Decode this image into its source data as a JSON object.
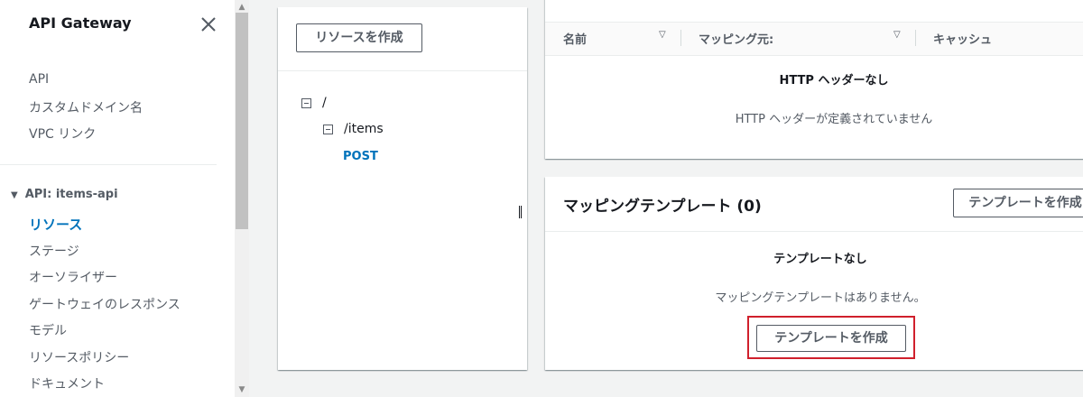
{
  "sidebar": {
    "title": "API Gateway",
    "top_links": [
      "API",
      "カスタムドメイン名",
      "VPC リンク"
    ],
    "section_label": "API: items-api",
    "section_links": [
      "リソース",
      "ステージ",
      "オーソライザー",
      "ゲートウェイのレスポンス",
      "モデル",
      "リソースポリシー",
      "ドキュメント"
    ],
    "active_item": "リソース"
  },
  "resources": {
    "create_button": "リソースを作成",
    "tree": [
      {
        "path": "/",
        "level": 0
      },
      {
        "path": "/items",
        "level": 1
      }
    ],
    "method": "POST"
  },
  "http_headers": {
    "columns": [
      "名前",
      "マッピング元:",
      "キャッシュ"
    ],
    "empty_title": "HTTP ヘッダーなし",
    "empty_text": "HTTP ヘッダーが定義されていません"
  },
  "mapping_templates": {
    "title": "マッピングテンプレート (0)",
    "header_button": "テンプレートを作成",
    "empty_title": "テンプレートなし",
    "empty_text": "マッピングテンプレートはありません。",
    "create_button": "テンプレートを作成"
  },
  "colors": {
    "accent": "#0073bb",
    "highlight": "#d0202c",
    "background": "#f2f3f3"
  }
}
